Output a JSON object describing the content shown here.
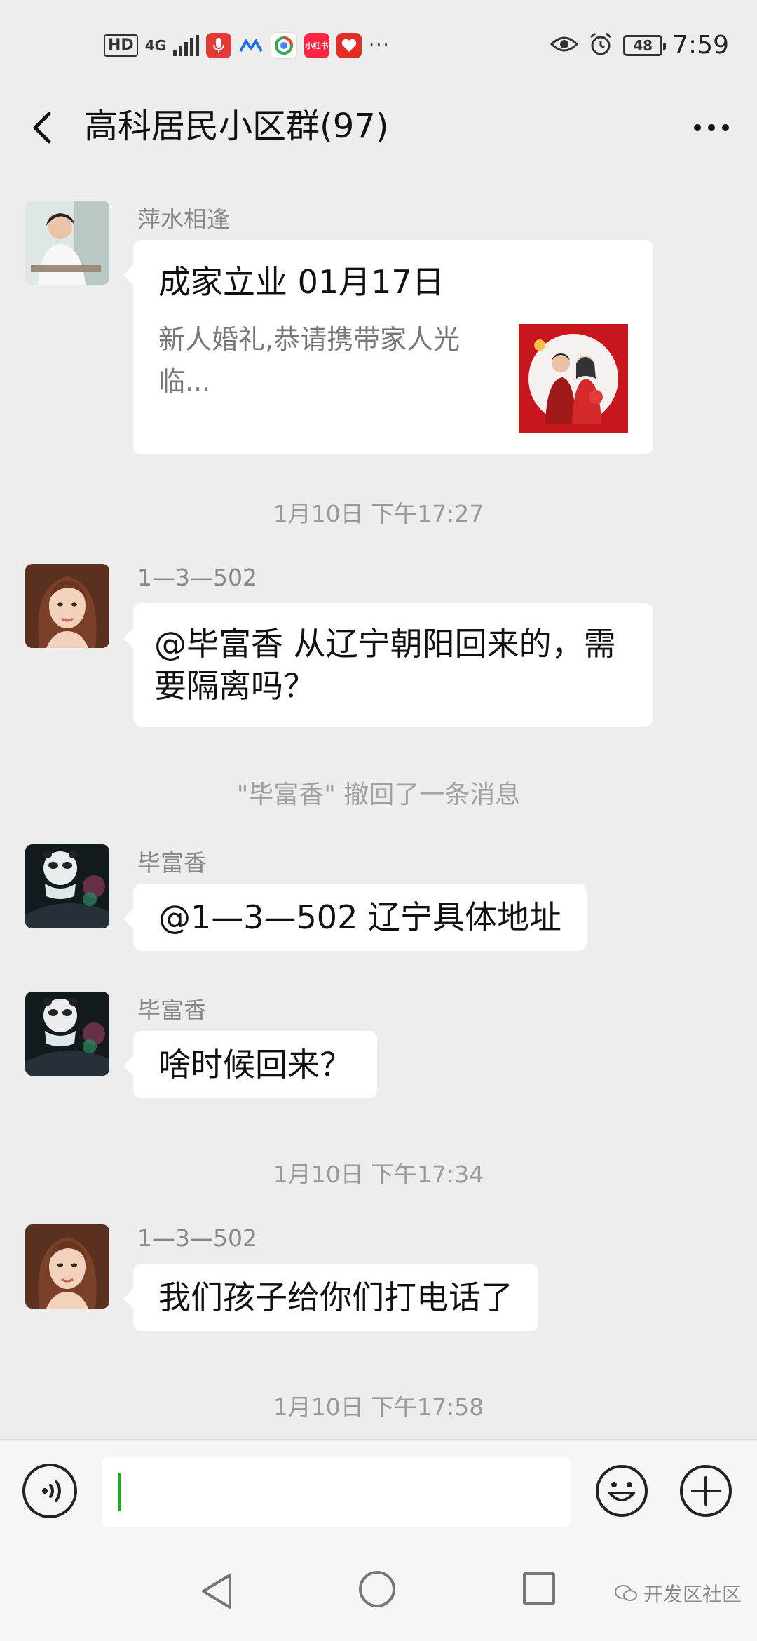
{
  "status_bar": {
    "hd": "HD",
    "network": "4G",
    "app_icons": [
      {
        "name": "recorder",
        "color": "#e53935",
        "glyph": "🎙"
      },
      {
        "name": "app-blue",
        "color": "#1e6fe0",
        "glyph": "M"
      },
      {
        "name": "app-colorful",
        "color": "#ffffff",
        "glyph": "◎"
      },
      {
        "name": "xiaohongshu",
        "color": "#ff2442",
        "glyph": "小红书"
      },
      {
        "name": "pinduoduo",
        "color": "#e02e24",
        "glyph": "♥"
      }
    ],
    "more": "···",
    "battery": "48",
    "time": "7:59"
  },
  "header": {
    "title": "高科居民小区群(97)"
  },
  "messages": [
    {
      "kind": "card",
      "sender": "萍水相逢",
      "card_title": "成家立业    01月17日",
      "card_desc": "新人婚礼,恭请携带家人光临..."
    },
    {
      "kind": "time",
      "text": "1月10日 下午17:27"
    },
    {
      "kind": "text",
      "sender": "1—3—502",
      "text": "@毕富香  从辽宁朝阳回来的，需要隔离吗？"
    },
    {
      "kind": "system",
      "text": "\"毕富香\" 撤回了一条消息"
    },
    {
      "kind": "text",
      "sender": "毕富香",
      "text": "@1—3—502  辽宁具体地址"
    },
    {
      "kind": "text",
      "sender": "毕富香",
      "text": "啥时候回来？"
    },
    {
      "kind": "time",
      "text": "1月10日 下午17:34"
    },
    {
      "kind": "text",
      "sender": "1—3—502",
      "text": "我们孩子给你们打电话了"
    },
    {
      "kind": "time",
      "text": "1月10日 下午17:58"
    }
  ],
  "input": {
    "value": "",
    "placeholder": ""
  },
  "watermark": "开发区社区",
  "colors": {
    "background": "#ededed",
    "bubble": "#ffffff",
    "caret": "#1aad19",
    "wedding_red": "#c8161d"
  }
}
